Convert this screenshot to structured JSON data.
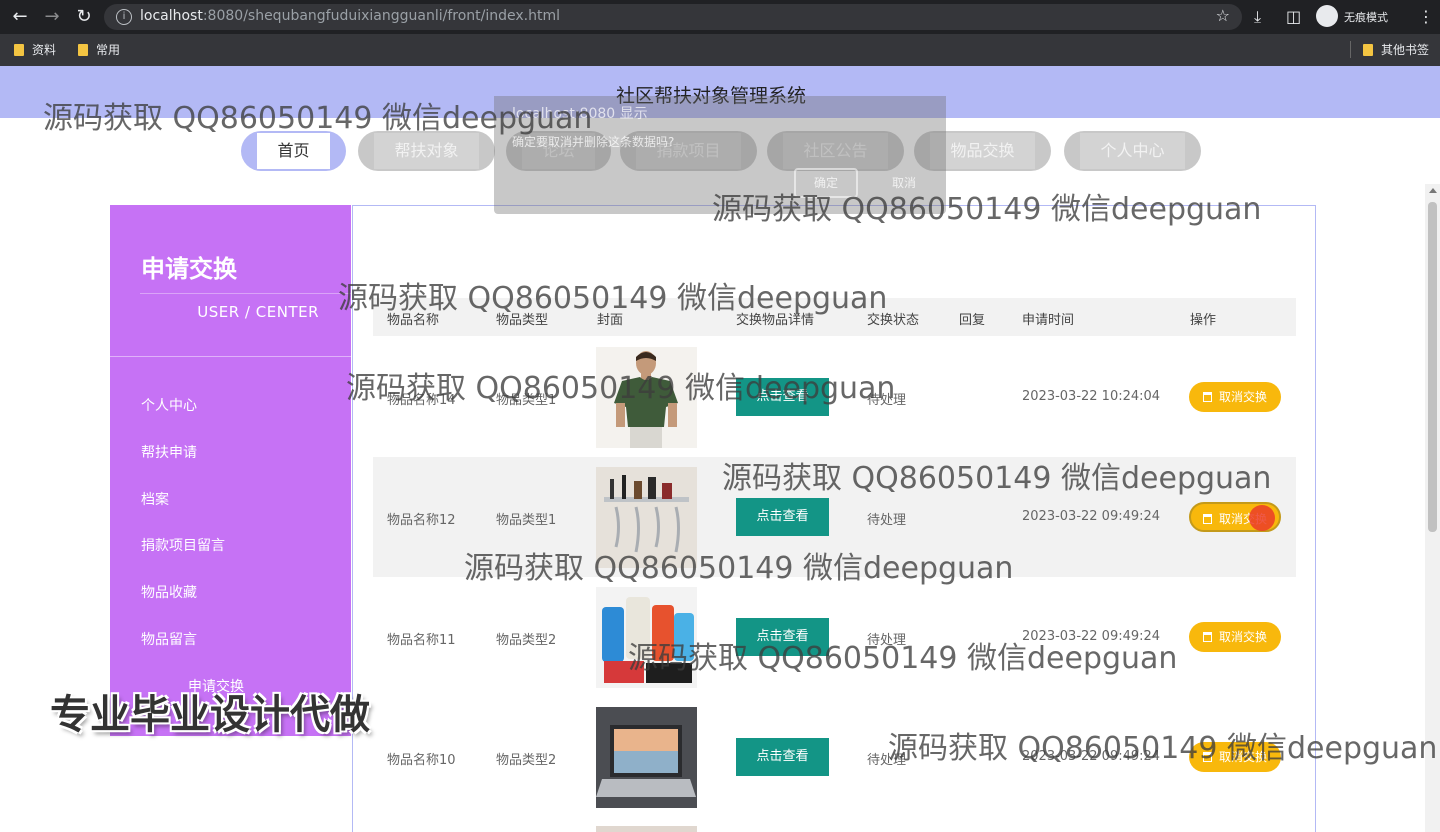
{
  "browser": {
    "url_host": "localhost",
    "url_rest": ":8080/shequbangfuduixiangguanli/front/index.html",
    "incognito_label": "无痕模式",
    "bookmarks": [
      "资料",
      "常用"
    ],
    "other_bookmarks": "其他书签"
  },
  "dialog": {
    "title": "localhost:8080 显示",
    "message": "确定要取消并删除这条数据吗?",
    "ok": "确定",
    "cancel": "取消"
  },
  "site": {
    "title": "社区帮扶对象管理系统",
    "nav": [
      "首页",
      "帮扶对象",
      "论坛",
      "捐款项目",
      "社区公告",
      "物品交换",
      "个人中心"
    ]
  },
  "sidebar": {
    "title": "申请交换",
    "subtitle": "USER / CENTER",
    "items": [
      "个人中心",
      "帮扶申请",
      "档案",
      "捐款项目留言",
      "物品收藏",
      "物品留言",
      "申请交换"
    ]
  },
  "table": {
    "headers": [
      "物品名称",
      "物品类型",
      "封面",
      "交换物品详情",
      "交换状态",
      "回复",
      "申请时间",
      "操作"
    ],
    "view_label": "点击查看",
    "cancel_label": "取消交换",
    "rows": [
      {
        "name": "物品名称14",
        "type": "物品类型1",
        "status": "待处理",
        "reply": "",
        "time": "2023-03-22 10:24:04"
      },
      {
        "name": "物品名称12",
        "type": "物品类型1",
        "status": "待处理",
        "reply": "",
        "time": "2023-03-22 09:49:24"
      },
      {
        "name": "物品名称11",
        "type": "物品类型2",
        "status": "待处理",
        "reply": "",
        "time": "2023-03-22 09:49:24"
      },
      {
        "name": "物品名称10",
        "type": "物品类型2",
        "status": "待处理",
        "reply": "",
        "time": "2023-03-22 09:49:24"
      }
    ]
  },
  "watermark": "源码获取 QQ86050149 微信deepguan",
  "promo": "专业毕业设计代做",
  "colors": {
    "banner": "#b3b9f5",
    "sidebar": "#c672f5",
    "view_button": "#139586",
    "cancel_button": "#f8b80c"
  }
}
